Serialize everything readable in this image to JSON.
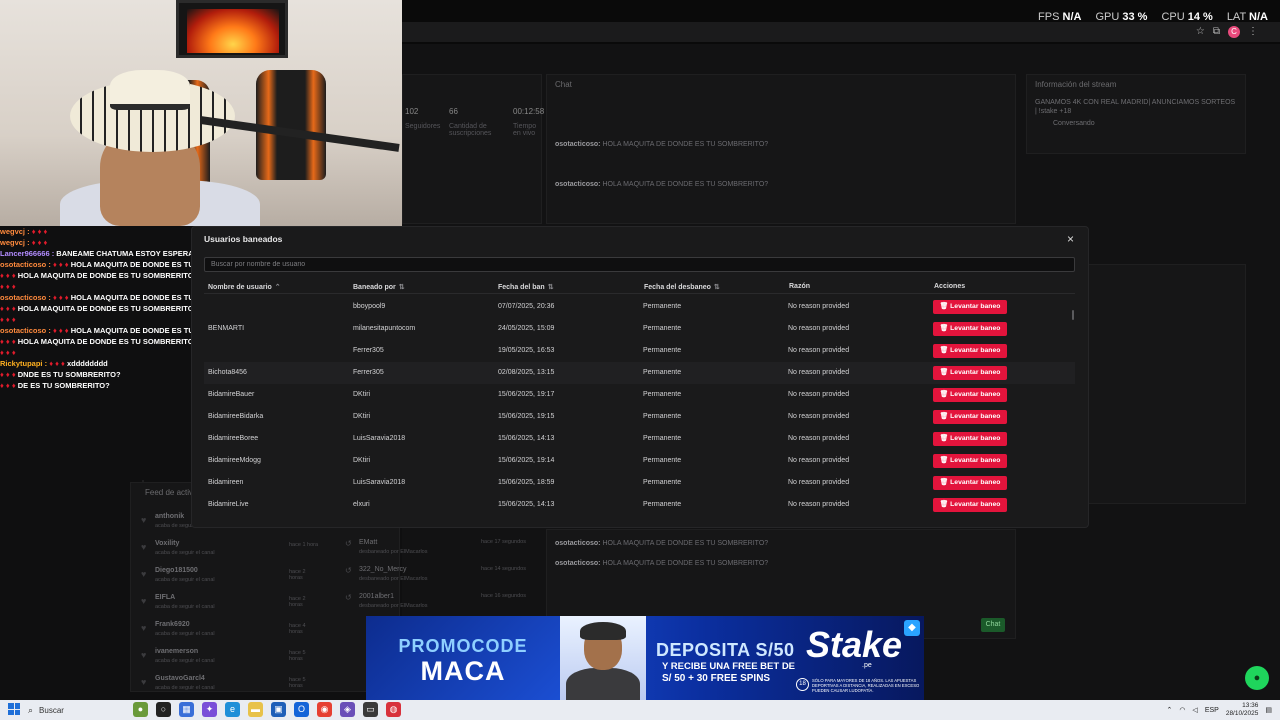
{
  "perf_overlay": {
    "fps_label": "FPS",
    "fps_value": "N/A",
    "gpu_label": "GPU",
    "gpu_value": "33 %",
    "cpu_label": "CPU",
    "cpu_value": "14 %",
    "lat_label": "LAT",
    "lat_value": "N/A"
  },
  "dashboard": {
    "chat_title": "Chat",
    "stream_info_title": "Información del stream",
    "stream_info_text": "GANAMOS 4K CON REAL MADRID| ANUNCIAMOS SORTEOS | !stake +18",
    "stream_info_category": "Conversando",
    "stats": [
      {
        "num": "102",
        "label": "Seguidores"
      },
      {
        "num": "66",
        "label": "Cantidad de suscripciones"
      },
      {
        "num": "00:12:58",
        "label": "Tiempo en vivo"
      }
    ],
    "feed_title": "Feed de actividad",
    "feed_items": [
      {
        "name": "anthonik",
        "sub": "acaba de seguir el canal",
        "time": "hace 1 hora"
      },
      {
        "name": "Voxility",
        "sub": "acaba de seguir el canal",
        "time": "hace 1 hora"
      },
      {
        "name": "Diego181500",
        "sub": "acaba de seguir el canal",
        "time": "hace 2 horas"
      },
      {
        "name": "EIFLA",
        "sub": "acaba de seguir el canal",
        "time": "hace 2 horas"
      },
      {
        "name": "Frank6920",
        "sub": "acaba de seguir el canal",
        "time": "hace 4 horas"
      },
      {
        "name": "ivanemerson",
        "sub": "acaba de seguir el canal",
        "time": "hace 5 horas"
      },
      {
        "name": "GustavoGarcl4",
        "sub": "acaba de seguir el canal",
        "time": "hace 5 horas"
      }
    ],
    "mod_items": [
      {
        "name": "EMatt",
        "sub": "desbaneado por ElMacarlos",
        "time": "hace 17 segundos"
      },
      {
        "name": "322_No_Mercy",
        "sub": "desbaneado por ElMacarlos",
        "time": "hace 14 segundos"
      },
      {
        "name": "2001alber1",
        "sub": "desbaneado por ElMacarlos",
        "time": "hace 16 segundos"
      }
    ],
    "chat_lines": [
      {
        "user": "osotacticoso:",
        "text": "HOLA MAQUITA DE DONDE ES TU SOMBRERITO?"
      },
      {
        "user": "osotacticoso:",
        "text": "HOLA MAQUITA DE DONDE ES TU SOMBRERITO?"
      }
    ],
    "chat_send": "Chat"
  },
  "stream_chat": [
    {
      "user": "wegvcj :",
      "text": "",
      "color": "o"
    },
    {
      "user": "wegvcj :",
      "text": "",
      "color": "o"
    },
    {
      "user": "Lancer966666 :",
      "text": "BANEAME CHATUMA ESTOY ESPERANDO XD",
      "color": "g"
    },
    {
      "user": "osotacticoso :",
      "text": "HOLA MAQUITA DE DONDE ES TU SOMBRERITO?",
      "color": "o"
    },
    {
      "user": "",
      "text": "HOLA MAQUITA DE DONDE ES TU SOMBRERITO?",
      "color": "o"
    },
    {
      "user": "",
      "text": "",
      "color": "o"
    },
    {
      "user": "osotacticoso :",
      "text": "HOLA MAQUITA DE DONDE ES TU SOMBRERITO?",
      "color": "o"
    },
    {
      "user": "",
      "text": "HOLA MAQUITA DE DONDE ES TU SOMBRERITO?",
      "color": "o"
    },
    {
      "user": "",
      "text": "",
      "color": "o"
    },
    {
      "user": "osotacticoso :",
      "text": "HOLA MAQUITA DE DONDE ES TU SOMBRERITO?",
      "color": "o"
    },
    {
      "user": "",
      "text": "HOLA MAQUITA DE DONDE ES TU SOMBRERITO?",
      "color": "o"
    },
    {
      "user": "",
      "text": "",
      "color": "o"
    },
    {
      "user": "Rickytupapi :",
      "text": "xdddddddd",
      "color": "y"
    },
    {
      "user": "",
      "text": "DNDE ES TU SOMBRERITO?",
      "color": "o"
    },
    {
      "user": "",
      "text": "DE ES TU SOMBRERITO?",
      "color": "o"
    }
  ],
  "modal": {
    "title": "Usuarios baneados",
    "close": "×",
    "search_placeholder": "Buscar por nombre de usuario",
    "columns": [
      "Nombre de usuario",
      "Baneado por",
      "Fecha del ban",
      "Fecha del desbaneo",
      "Razón",
      "Acciones"
    ],
    "column_sort": [
      "⌃",
      "⇅",
      "⇅",
      "⇅",
      "",
      ""
    ],
    "action_label": "Levantar baneo",
    "rows": [
      {
        "user": "",
        "by": "bboypool9",
        "ban": "07/07/2025, 20:36",
        "unban": "Permanente",
        "reason": "No reason provided"
      },
      {
        "user": "BENMARTI",
        "by": "milanesitapuntocom",
        "ban": "24/05/2025, 15:09",
        "unban": "Permanente",
        "reason": "No reason provided"
      },
      {
        "user": "",
        "by": "Ferrer305",
        "ban": "19/05/2025, 16:53",
        "unban": "Permanente",
        "reason": "No reason provided"
      },
      {
        "user": "Bichota8456",
        "by": "Ferrer305",
        "ban": "02/08/2025, 13:15",
        "unban": "Permanente",
        "reason": "No reason provided"
      },
      {
        "user": "BidamireBauer",
        "by": "DKtiri",
        "ban": "15/06/2025, 19:17",
        "unban": "Permanente",
        "reason": "No reason provided"
      },
      {
        "user": "BidamireeBidarka",
        "by": "DKtiri",
        "ban": "15/06/2025, 19:15",
        "unban": "Permanente",
        "reason": "No reason provided"
      },
      {
        "user": "BidamireeBoree",
        "by": "LuisSaravia2018",
        "ban": "15/06/2025, 14:13",
        "unban": "Permanente",
        "reason": "No reason provided"
      },
      {
        "user": "BidamireeMdogg",
        "by": "DKtiri",
        "ban": "15/06/2025, 19:14",
        "unban": "Permanente",
        "reason": "No reason provided"
      },
      {
        "user": "Bidamireen",
        "by": "LuisSaravia2018",
        "ban": "15/06/2025, 18:59",
        "unban": "Permanente",
        "reason": "No reason provided"
      },
      {
        "user": "BidamireLive",
        "by": "elxuri",
        "ban": "15/06/2025, 14:13",
        "unban": "Permanente",
        "reason": "No reason provided"
      }
    ]
  },
  "banner": {
    "promo_line1": "PROMOCODE",
    "promo_line2": "MACA",
    "deposit": "DEPOSITA S/50",
    "sub1": "Y RECIBE UNA FREE BET DE",
    "sub2": "S/ 50 + 30 FREE SPINS",
    "brand": "Stake",
    "brand_suffix": ".pe",
    "age": "18",
    "legal": "SÓLO PARA MAYORES DE 18 AÑOS. LAS APUESTAS DEPORTIVAS A DISTANCIA, REALIZADAS EN EXCESO PUEDEN CAUSAR LUDOPATÍA."
  },
  "taskbar": {
    "search": "Buscar",
    "lang": "ESP",
    "time": "13:36",
    "date": "28/10/2025"
  },
  "colors": {
    "accent_red": "#e3143c",
    "modal_bg": "#1a1a1b",
    "fab_green": "#1fd55c"
  }
}
